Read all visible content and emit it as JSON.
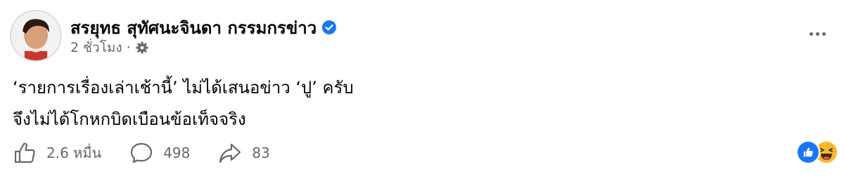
{
  "post": {
    "author": "สรยุทธ สุทัศนะจินดา กรรมกรข่าว",
    "time": "2 ชั่วโมง",
    "separator": "·",
    "lines": [
      "‘รายการเรื่องเล่าเช้านี้’ ไม่ได้เสนอข่าว ‘ปู’ ครับ",
      "จึงไม่ได้โกหกบิดเบือนข้อเท็จจริง"
    ]
  },
  "stats": {
    "likes": "2.6 หมื่น",
    "comments": "498",
    "shares": "83"
  },
  "icons": {
    "verified": "verified-badge-icon",
    "privacy": "gear-icon",
    "more": "more-options-icon",
    "like": "like-icon",
    "comment": "comment-icon",
    "share": "share-icon",
    "reaction_like": "like-reaction-icon",
    "reaction_haha": "haha-reaction-icon"
  },
  "colors": {
    "accent": "#1877f2",
    "secondary_text": "#65676b",
    "haha": "#f7b928"
  }
}
